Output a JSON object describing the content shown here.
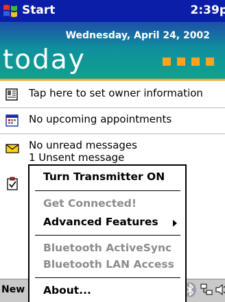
{
  "titlebar": {
    "start_label": "Start",
    "clock": "2:39p"
  },
  "today": {
    "date": "Wednesday, April 24, 2002",
    "title": "today"
  },
  "rows": {
    "owner": "Tap here to set owner information",
    "appointments": "No upcoming appointments",
    "messages_line1": "No unread messages",
    "messages_line2": "1 Unsent message"
  },
  "menu": {
    "transmitter": "Turn Transmitter ON",
    "get_connected": "Get Connected!",
    "advanced": "Advanced Features",
    "activesync": "Bluetooth ActiveSync",
    "lan_access": "Bluetooth LAN Access",
    "about": "About..."
  },
  "bottombar": {
    "new_label": "New"
  },
  "colors": {
    "titlebar": "#0b1ea8",
    "accent_orange": "#ffa21e",
    "disabled_text": "#8c8c8c"
  },
  "icons": [
    "windows-flag-icon",
    "owner-card-icon",
    "calendar-icon",
    "envelope-icon",
    "clipboard-check-icon",
    "bluetooth-icon",
    "network-icon",
    "speaker-icon"
  ]
}
